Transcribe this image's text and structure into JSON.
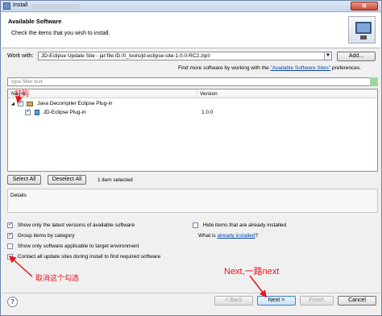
{
  "window": {
    "title": "Install",
    "close_glyph": "✕"
  },
  "banner": {
    "heading": "Available Software",
    "description": "Check the items that you wish to install.",
    "icon": "monitor-icon"
  },
  "work_with": {
    "label": "Work with:",
    "value": "JD-Eclipse Update Site - jar:file:/D:/0_tools/jd-eclipse-site-1.0.0-RC2.zip!/",
    "add_label": "Add...",
    "find_more_prefix": "Find more software by working with the",
    "find_more_link": "\"Available Software Sites\"",
    "find_more_suffix": "preferences."
  },
  "filter": {
    "placeholder": "type filter text"
  },
  "tree": {
    "columns": [
      "Name",
      "Version"
    ],
    "items": [
      {
        "name": "Java Decompiler Eclipse Plug-in",
        "version": "",
        "checked": true
      },
      {
        "name": "JD-Eclipse Plug-in",
        "version": "1.0.0",
        "checked": true
      }
    ]
  },
  "selection": {
    "select_all": "Select All",
    "deselect_all": "Deselect All",
    "info": "1 item selected"
  },
  "details": {
    "label": "Details"
  },
  "options": {
    "latest_only": "Show only the latest versions of available software",
    "group_by_category": "Group items by category",
    "applicable_only": "Show only software applicable to target environment",
    "contact_all": "Contact all update sites during install to find required software",
    "hide_installed": "Hide items that are already installed",
    "what_is_prefix": "What is",
    "what_is_link": "already installed",
    "what_is_suffix": "?"
  },
  "buttons": {
    "back": "< Back",
    "next": "Next >",
    "finish": "Finish",
    "cancel": "Cancel",
    "help": "?"
  },
  "annotations": {
    "check_hook": "打钩",
    "uncheck_this": "取消这个勾选",
    "next_all_the_way": "Next,一路next"
  },
  "colors": {
    "annotation": "#e8141b",
    "link": "#0645ad"
  }
}
